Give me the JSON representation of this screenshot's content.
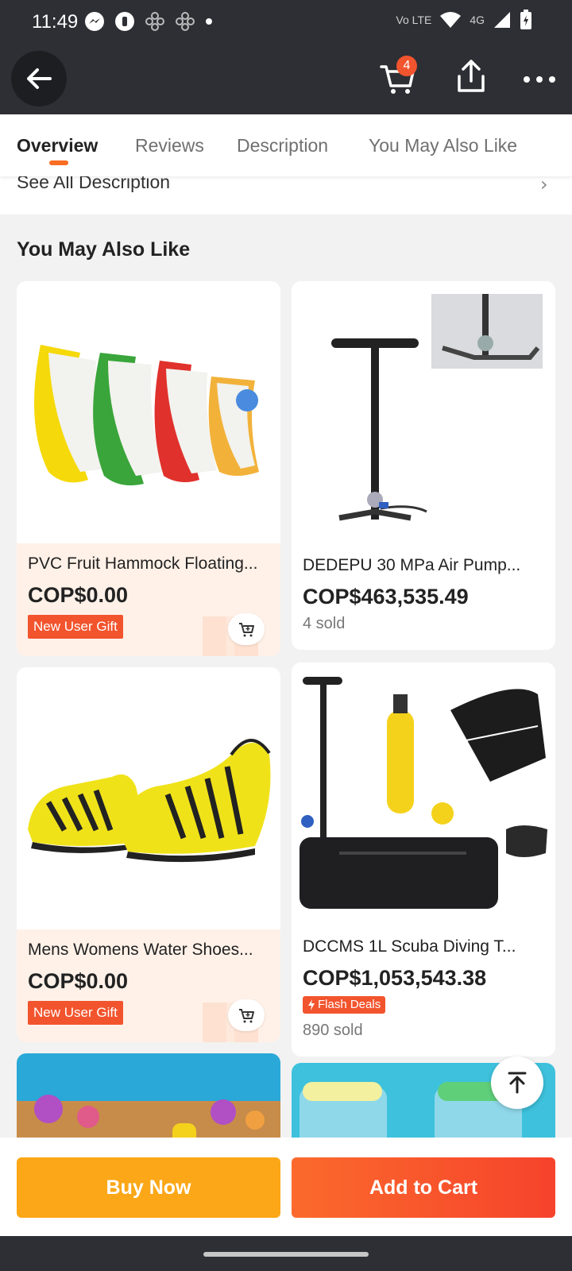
{
  "status_bar": {
    "time": "11:49",
    "network": "4G",
    "volte": "Vo LTE"
  },
  "header": {
    "cart_count": "4"
  },
  "tabs": [
    {
      "label": "Overview",
      "active": true
    },
    {
      "label": "Reviews",
      "active": false
    },
    {
      "label": "Description",
      "active": false
    },
    {
      "label": "You May Also Like",
      "active": false
    }
  ],
  "description": {
    "link_label": "See All Description"
  },
  "recommendations": {
    "title": "You May Also Like",
    "products": [
      {
        "title": "PVC Fruit Hammock Floating...",
        "price": "COP$0.00",
        "badge": "New User Gift"
      },
      {
        "title": "DEDEPU 30 MPa Air Pump...",
        "price": "COP$463,535.49",
        "sold": "4 sold"
      },
      {
        "title": "Mens Womens Water Shoes...",
        "price": "COP$0.00",
        "badge": "New User Gift"
      },
      {
        "title": "DCCMS 1L Scuba Diving T...",
        "price": "COP$1,053,543.38",
        "badge": "Flash Deals",
        "sold": "890 sold"
      }
    ]
  },
  "actions": {
    "buy_now": "Buy Now",
    "add_to_cart": "Add to Cart"
  },
  "colors": {
    "accent_orange": "#f96d23",
    "buy_now": "#fba717",
    "add_to_cart": "#f6432c",
    "badge": "#f2542d",
    "dark_bar": "#2e2f35"
  }
}
